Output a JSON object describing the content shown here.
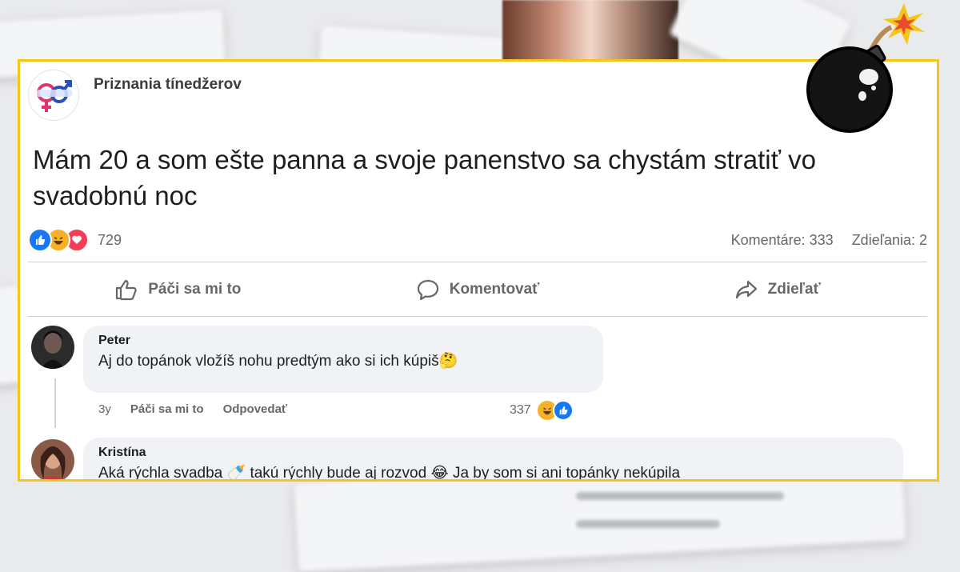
{
  "post": {
    "page_name": "Priznania tínedžerov",
    "text": "Mám 20 a som ešte panna a svoje panenstvo sa chystám stratiť vo svadobnú noc",
    "reactions": {
      "types": [
        "like",
        "haha",
        "love"
      ],
      "count": "729"
    },
    "comments_count": "Komentáre: 333",
    "shares_count": "Zdieľania: 2"
  },
  "actions": {
    "like_label": "Páči sa mi to",
    "comment_label": "Komentovať",
    "share_label": "Zdieľať"
  },
  "comments": [
    {
      "author": "Peter",
      "text": "Aj do topánok vložíš nohu predtým ako si ich kúpiš🤔",
      "age": "3y",
      "like_label": "Páči sa mi to",
      "reply_label": "Odpovedať",
      "reactions_count": "337",
      "reactions": [
        "haha",
        "like"
      ]
    },
    {
      "author": "Kristína",
      "text": "Aká rýchla svadba 🍼 takú rýchly bude aj rozvod 😂 Ja by som si ani topánky nekúpila"
    }
  ],
  "colors": {
    "frame": "#f5c518",
    "like_blue": "#1877f2",
    "haha_yellow": "#f7b125",
    "love_red": "#f33e58",
    "bubble": "#f0f2f5"
  },
  "icons": [
    "like-outline-icon",
    "comment-outline-icon",
    "share-outline-icon",
    "bomb-icon"
  ]
}
